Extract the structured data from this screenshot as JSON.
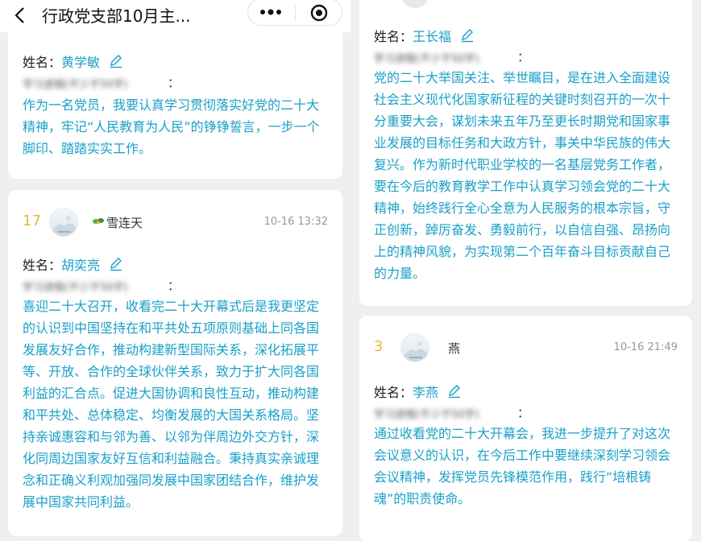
{
  "nav": {
    "title": "行政党支部10月主..."
  },
  "left_top": {
    "name_label": "姓名：",
    "name": "黄学敏",
    "question": "学习进程(不少于50字)",
    "answer": "作为一名党员，我要认真学习贯彻落实好党的二十大精神，牢记“人民教育为人民”的铮铮誓言，一步一个脚印、踏踏实实工作。"
  },
  "card17": {
    "rank": "17",
    "nickname": "雪连天",
    "time": "10-16 13:32",
    "name_label": "姓名：",
    "name": "胡奕亮",
    "question": "学习进程(不少于50字)",
    "answer": "喜迎二十大召开，收看完二十大开幕式后是我更坚定的认识到中国坚持在和平共处五项原则基础上同各国发展友好合作，推动构建新型国际关系，深化拓展平等、开放、合作的全球伙伴关系，致力于扩大同各国利益的汇合点。促进大国协调和良性互动，推动构建和平共处、总体稳定、均衡发展的大国关系格局。坚持亲诚惠容和与邻为善、以邻为伴周边外交方针，深化同周边国家友好互信和利益融合。秉持真实亲诚理念和正确义利观加强同发展中国家团结合作，维护发展中国家共同利益。"
  },
  "right_top": {
    "name_label": "姓名：",
    "name": "王长福",
    "question": "学习进程(不少于50字)",
    "answer": "党的二十大举国关注、举世瞩目，是在进入全面建设社会主义现代化国家新征程的关键时刻召开的一次十分重要大会，谋划未来五年乃至更长时期党和国家事业发展的目标任务和大政方针，事关中华民族的伟大复兴。作为新时代职业学校的一名基层党务工作者，要在今后的教育教学工作中认真学习领会党的二十大精神，始终践行全心全意为人民服务的根本宗旨，守正创新，踔厉奋发、勇毅前行，以自信自强、昂扬向上的精神风貌，为实现第二个百年奋斗目标贡献自己的力量。"
  },
  "card3": {
    "rank": "3",
    "nickname": "燕",
    "time": "10-16 21:49",
    "name_label": "姓名：",
    "name": "李燕",
    "question": "学习进程(不少于50字)",
    "answer": "通过收看党的二十大开幕会，我进一步提升了对这次会议意义的认识，在今后工作中要继续深刻学习领会会议精神，发挥党员先锋模范作用，践行“培根铸魂”的职责使命。"
  },
  "colors": {
    "accent": "#1aa0c8",
    "rank": "#e8b64a",
    "background": "#efefef"
  },
  "icons": [
    "back-arrow-icon",
    "more-dots-icon",
    "target-icon",
    "edit-pencil-icon",
    "avatar-icon",
    "leaf-icon"
  ]
}
